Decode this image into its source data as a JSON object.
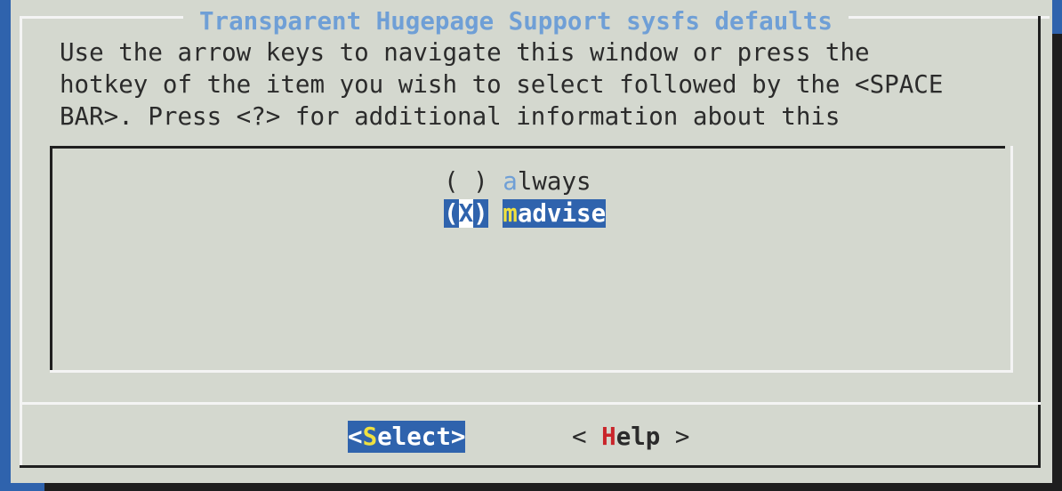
{
  "dialog": {
    "title": "Transparent Hugepage Support sysfs defaults",
    "description_lines": [
      "Use the arrow keys to navigate this window or press the",
      "hotkey of the item you wish to select followed by the <SPACE",
      "BAR>. Press <?> for additional information about this"
    ]
  },
  "options": [
    {
      "marker_open": "(",
      "marker_value": " ",
      "marker_close": ")",
      "hotkey": "a",
      "label_rest": "lways",
      "selected": false
    },
    {
      "marker_open": "(",
      "marker_value": "X",
      "marker_close": ")",
      "hotkey": "m",
      "label_rest": "advise",
      "selected": true
    }
  ],
  "buttons": {
    "select": {
      "open": "<",
      "hotkey": "S",
      "rest": "elect",
      "close": ">"
    },
    "help": {
      "open": "< ",
      "hotkey": "H",
      "rest": "elp",
      "close": " >"
    }
  },
  "colors": {
    "background": "#2f63ad",
    "dialog": "#d4d8cf",
    "highlight": "#2f63ad",
    "title": "#6f9fd6",
    "hotkey_yellow": "#f0e140",
    "hotkey_red": "#c9252a"
  }
}
